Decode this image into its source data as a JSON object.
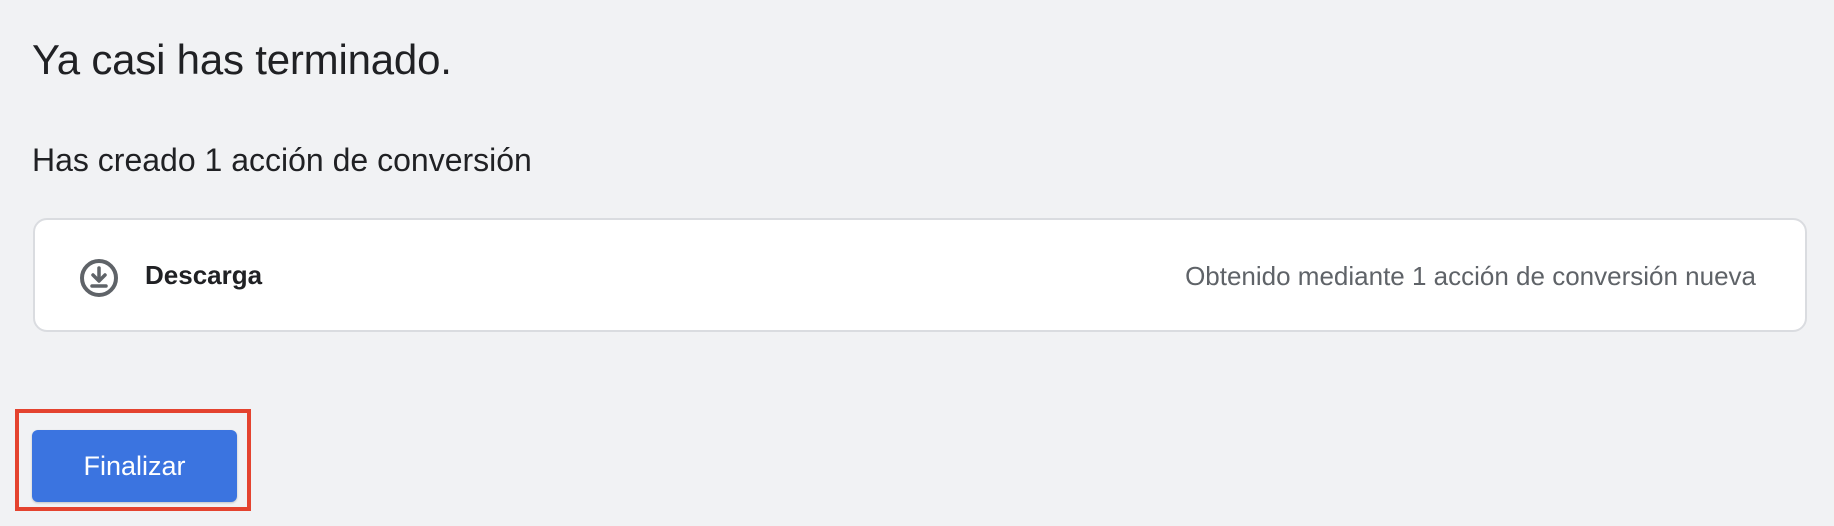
{
  "page": {
    "title": "Ya casi has terminado.",
    "subtitle": "Has creado 1 acción de conversión"
  },
  "goal": {
    "icon": "download-circle-icon",
    "name": "Descarga",
    "status": "Obtenido mediante 1 acción de conversión nueva"
  },
  "actions": {
    "finish_label": "Finalizar"
  },
  "colors": {
    "background": "#f1f2f4",
    "button": "#3b74e0",
    "highlight": "#e4432f",
    "secondary_text": "#5f6368"
  }
}
